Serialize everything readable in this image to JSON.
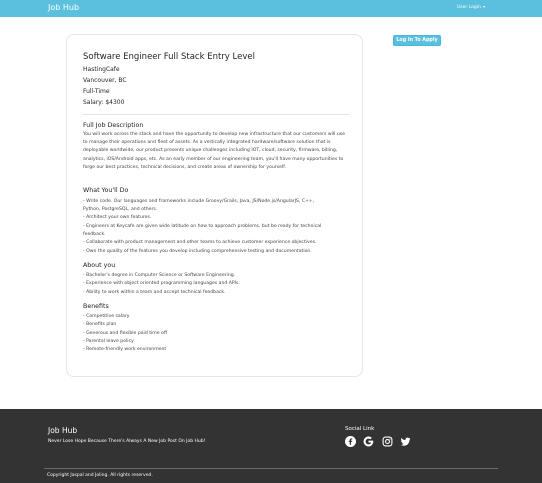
{
  "navbar": {
    "brand": "Job Hub",
    "user_login": "User Login"
  },
  "job": {
    "title": "Software Engineer Full Stack Entry Level",
    "company": "HastingCafe",
    "location": "Vancouver, BC",
    "type": "Full-Time",
    "salary": "Salary: $4300"
  },
  "description": {
    "title": "Full Job Description",
    "text": "You will work across the stack and have the opportunity to develop new infrastructure that our customers will use to manage their operations and fleet of assets. As a vertically integrated hardware/software solution that is deployable worldwide, our product presents unique challenges including IOT, cloud, security, firmware, billing, analytics, iOS/Android apps, etc. As an early member of our engineering team, you'll have many opportunities to forge our best practices, technical decisions, and create areas of ownership for yourself."
  },
  "what_youll_do": {
    "title": "What You'll Do",
    "lines": [
      "- Write code. Our languages and frameworks include Groovy/Grails, Java, JS/Node.js/AngularJS, C++,",
      "Python, PostgreSQL, and others.",
      "- Architect your own features.",
      "- Engineers at Keycafe are given wide latitude on how to approach problems, but be ready for technical",
      "feedback.",
      "- Collaborate with product management and other teams to achieve customer experience objectives.",
      "- Own the quality of the features you develop including comprehensive testing and documentation."
    ]
  },
  "about_you": {
    "title": "About you",
    "lines": [
      "- Bachelor's degree in Computer Science or Software Engineering.",
      "- Experience with object oriented programming languages and APIs.",
      "- Ability to work within a team and accept technical feedback."
    ]
  },
  "benefits": {
    "title": "Benefits",
    "lines": [
      "- Competitive salary",
      "- Benefits plan",
      "- Generous and flexible paid time off",
      "- Parental leave policy",
      "- Remote-friendly work environment"
    ]
  },
  "apply_button": "Log In To Apply",
  "footer": {
    "brand": "Job Hub",
    "tagline": "Never Lose Hope Because There's Always A New Job Post On Job Hub!",
    "social_title": "Social Link",
    "social_icons": [
      "facebook-icon",
      "google-icon",
      "instagram-icon",
      "twitter-icon"
    ],
    "copyright": "Copyright Jaspal and Joling. All rights reserved."
  },
  "colors": {
    "navbar": "#5bc0de",
    "button": "#5bc0de",
    "footer": "#333333"
  }
}
